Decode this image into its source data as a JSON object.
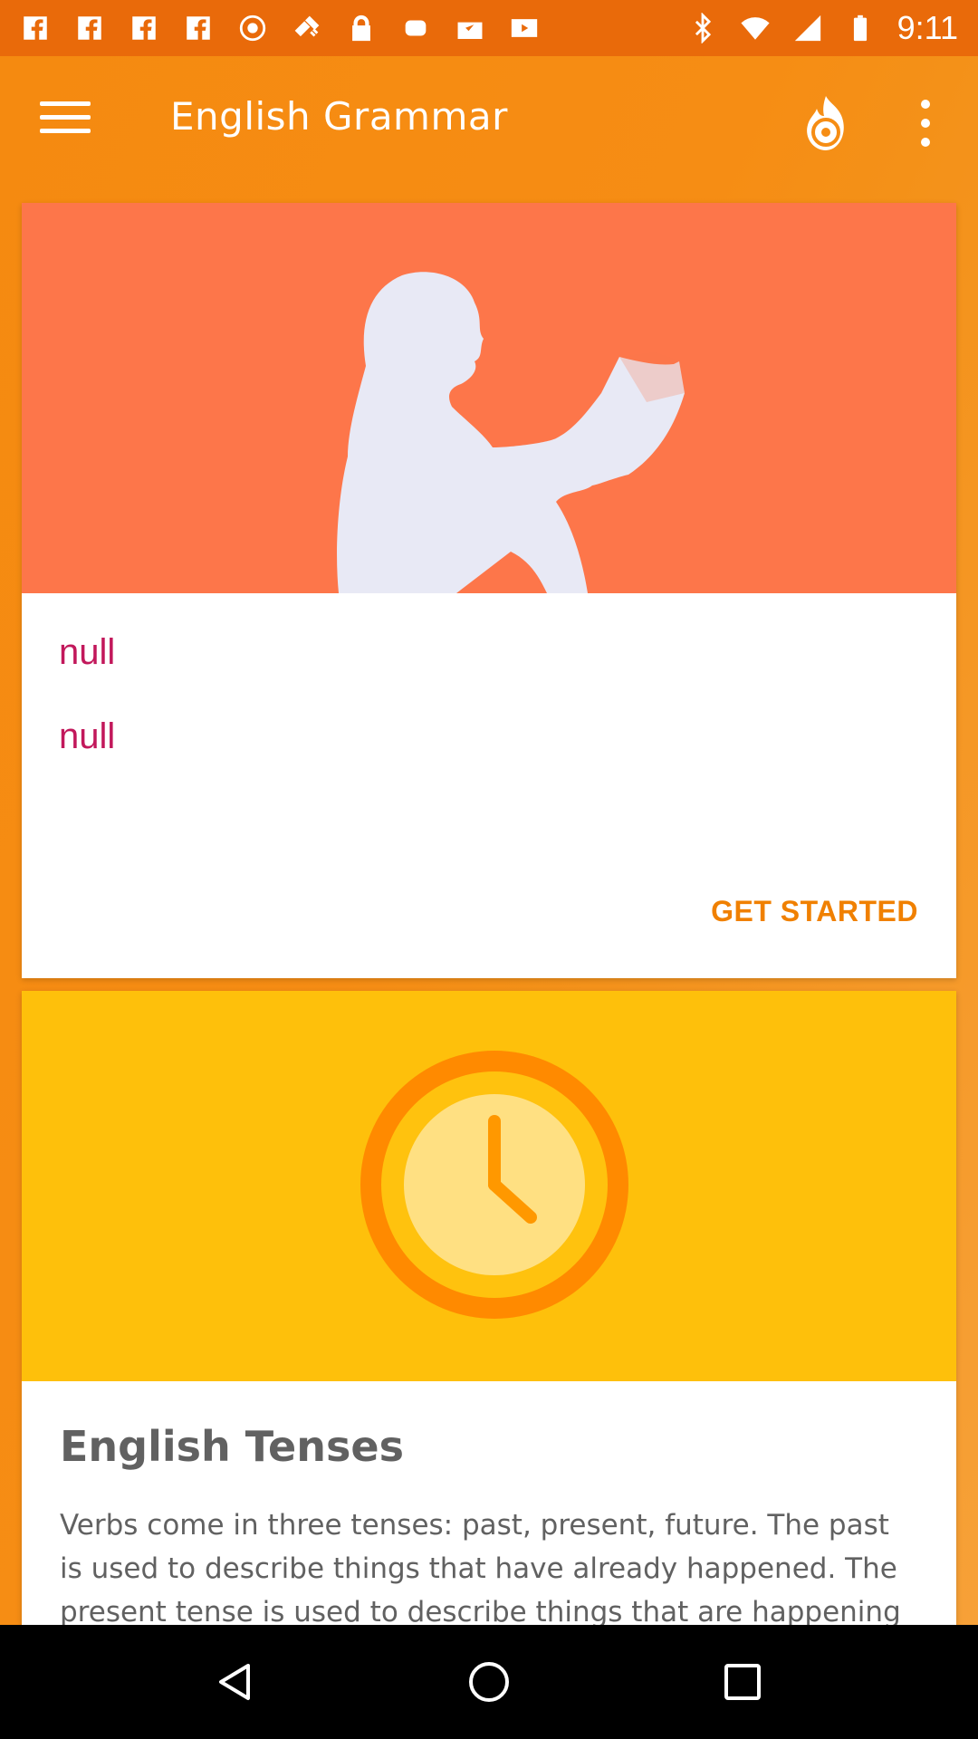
{
  "status_bar": {
    "time": "9:11",
    "left_icons": [
      "fb-icon",
      "fb-icon",
      "fb-icon",
      "fb-icon",
      "record-icon",
      "satellite-fake-gps-icon",
      "lock-icon",
      "android-icon",
      "inbox-check-icon",
      "play-icon"
    ],
    "right_icons": [
      "bluetooth-icon",
      "wifi-icon",
      "signal-icon",
      "battery-icon"
    ]
  },
  "app_bar": {
    "title": "English Grammar",
    "menu_icon": "hamburger-menu-icon",
    "action_icon": "fire-disc-icon",
    "overflow_icon": "more-vert-icon"
  },
  "cards": [
    {
      "image": "woman-reading-silhouette",
      "line1": "null",
      "line2": "null",
      "action": "GET STARTED"
    },
    {
      "image": "clock-icon",
      "title": "English Tenses",
      "body": "Verbs come in three tenses: past, present, future. The past is used to describe things that have already happened. The present tense is used to describe things that are happening"
    }
  ],
  "nav_bar": {
    "back": "back-triangle-icon",
    "home": "home-circle-icon",
    "recents": "recents-square-icon"
  },
  "colors": {
    "status_bar": "#e96a0a",
    "app_bar": "#f68d14",
    "card1_hero": "#fd764a",
    "card2_hero": "#fec00b",
    "null_text": "#c2185b",
    "action_text": "#f08000"
  }
}
